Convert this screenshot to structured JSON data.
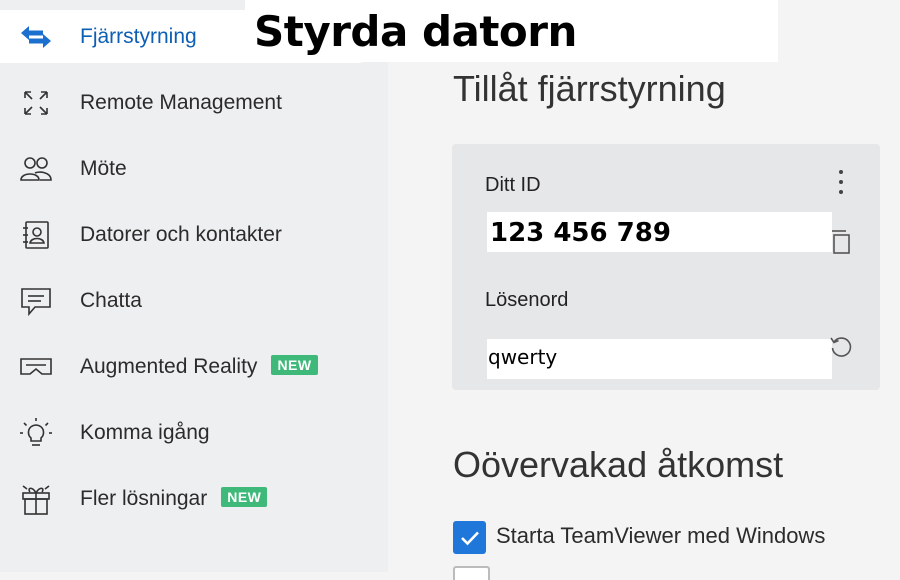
{
  "overlay_heading": "Styrda datorn",
  "sidebar": {
    "items": [
      {
        "label": "Fjärrstyrning",
        "icon": "arrows-swap-icon",
        "active": true
      },
      {
        "label": "Remote Management",
        "icon": "expand-arrows-icon"
      },
      {
        "label": "Möte",
        "icon": "people-icon"
      },
      {
        "label": "Datorer och kontakter",
        "icon": "contact-card-icon"
      },
      {
        "label": "Chatta",
        "icon": "chat-bubble-icon"
      },
      {
        "label": "Augmented Reality",
        "icon": "ar-goggles-icon",
        "badge": "NEW"
      },
      {
        "label": "Komma igång",
        "icon": "lightbulb-icon"
      },
      {
        "label": "Fler lösningar",
        "icon": "gift-box-icon",
        "badge": "NEW"
      }
    ]
  },
  "main": {
    "allow_title": "Tillåt fjärrstyrning",
    "id_label": "Ditt ID",
    "id_value": "123 456 789",
    "password_label": "Lösenord",
    "password_value": "qwerty",
    "unattended_title": "Oövervakad åtkomst",
    "start_with_windows_label": "Starta TeamViewer med Windows",
    "start_with_windows_checked": true
  },
  "colors": {
    "accent": "#1f78d9",
    "active_text": "#0d5fb5",
    "badge": "#3fb97a",
    "sidebar_bg": "#eeeff0",
    "main_bg": "#f4f4f5",
    "card_bg": "#e6e7e8"
  }
}
